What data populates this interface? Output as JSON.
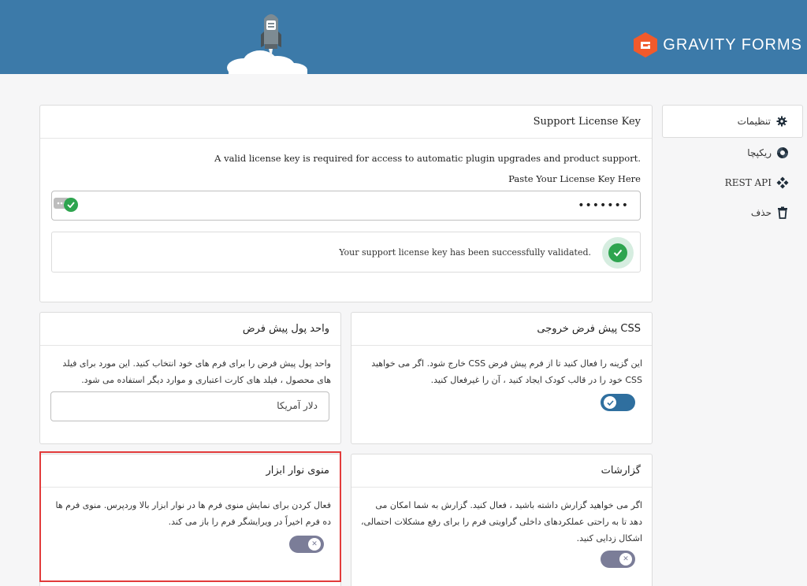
{
  "header": {
    "brand": "GRAVITY FORMS"
  },
  "nav": {
    "items": [
      {
        "label": "تنظیمات",
        "icon": "gear-icon",
        "active": true
      },
      {
        "label": "ریکپچا",
        "icon": "recaptcha-icon",
        "active": false
      },
      {
        "label": "REST API",
        "icon": "api-icon",
        "active": false
      },
      {
        "label": "حذف",
        "icon": "trash-icon",
        "active": false
      }
    ]
  },
  "license": {
    "title": "Support License Key",
    "description": "A valid license key is required for access to automatic plugin upgrades and product support.",
    "field_label": "Paste Your License Key Here",
    "field_value": "•••••••",
    "success_message": "Your support license key has been successfully validated."
  },
  "css_card": {
    "title": "CSS پیش فرض خروجی",
    "description": "این گزینه را فعال کنید تا از فرم پیش فرض CSS خارج شود. اگر می خواهید CSS خود را در قالب کودک ایجاد کنید ، آن را غیرفعال کنید.",
    "toggle": "on"
  },
  "currency_card": {
    "title": "واحد پول پیش فرض",
    "description": "واحد پول پیش فرض را برای فرم های خود انتخاب کنید. این مورد برای فیلد های محصول ، فیلد های کارت اعتباری و موارد دیگر استفاده می شود.",
    "selected": "دلار آمریکا"
  },
  "logging_card": {
    "title": "گزارشات",
    "description": "اگر می خواهید گزارش داشته باشید ، فعال کنید. گزارش به شما امکان می دهد تا به راحتی عملکردهای داخلی گراویتی فرم را برای رفع مشکلات احتمالی، اشکال زدایی کنید.",
    "toggle": "off"
  },
  "toolbar_card": {
    "title": "منوی نوار ابزار",
    "description": "فعال کردن برای نمایش منوی فرم ها در نوار ابزار بالا وردپرس. منوی فرم ها ده فرم اخیراً در ویرایشگر فرم را باز می کند.",
    "toggle": "off"
  },
  "colors": {
    "banner": "#3c7aa9",
    "success": "#2ea44f",
    "toggle_on": "#2f6f9f",
    "toggle_off": "#7b7d98",
    "highlight": "#e23b3b"
  }
}
